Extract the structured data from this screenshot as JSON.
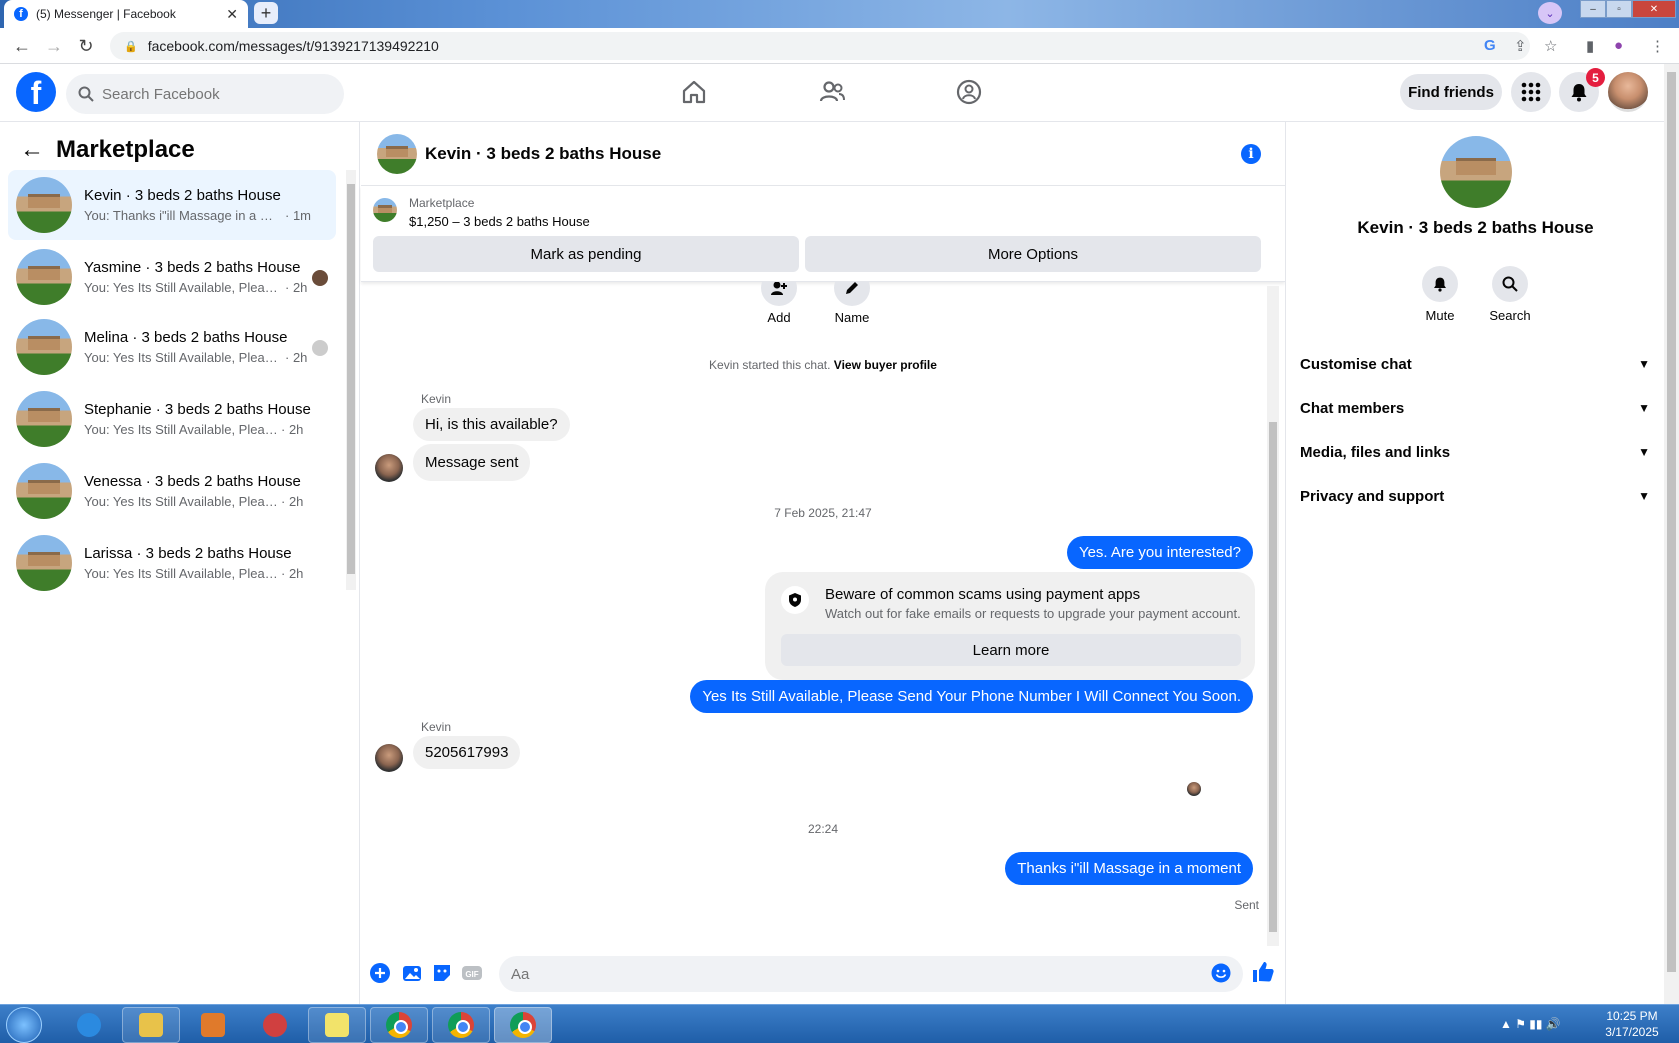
{
  "browser": {
    "tab_title": "(5) Messenger | Facebook",
    "url": "facebook.com/messages/t/9139217139492210"
  },
  "header": {
    "search_placeholder": "Search Facebook",
    "find_friends": "Find friends",
    "notification_count": "5"
  },
  "left": {
    "title": "Marketplace",
    "conversations": [
      {
        "name": "Kevin · 3 beds 2 baths House",
        "preview": "You: Thanks i\"ill Massage in a mo...",
        "time": "· 1m",
        "active": true
      },
      {
        "name": "Yasmine · 3 beds 2 baths House",
        "preview": "You: Yes Its Still Available, Please...",
        "time": "· 2h"
      },
      {
        "name": "Melina · 3 beds 2 baths House",
        "preview": "You: Yes Its Still Available, Please...",
        "time": "· 2h"
      },
      {
        "name": "Stephanie · 3 beds 2 baths House",
        "preview": "You: Yes Its Still Available, Please Se...",
        "time": "· 2h"
      },
      {
        "name": "Venessa · 3 beds 2 baths House",
        "preview": "You: Yes Its Still Available, Please Se...",
        "time": "· 2h"
      },
      {
        "name": "Larissa · 3 beds 2 baths House",
        "preview": "You: Yes Its Still Available, Please Se...",
        "time": "· 2h"
      }
    ]
  },
  "chat": {
    "title": "Kevin · 3 beds 2 baths House",
    "marketplace_label": "Marketplace",
    "listing": "$1,250 – 3 beds 2 baths House",
    "mark_pending": "Mark as pending",
    "more_options": "More Options",
    "action_add": "Add",
    "action_name": "Name",
    "started_text": "Kevin started this chat.",
    "view_profile": "View buyer profile",
    "sender_kevin": "Kevin",
    "msg_1": "Hi, is this available?",
    "msg_2": "Message sent",
    "timestamp_1": "7 Feb 2025, 21:47",
    "msg_3": "Yes. Are you interested?",
    "scam_title": "Beware of common scams using payment apps",
    "scam_sub": "Watch out for fake emails or requests to upgrade your payment account.",
    "learn_more": "Learn more",
    "msg_4": "Yes Its Still Available, Please Send Your Phone Number I Will Connect You Soon.",
    "msg_5": "5205617993",
    "timestamp_2": "22:24",
    "msg_6": "Thanks i\"ill Massage in a moment",
    "sent_label": "Sent",
    "input_placeholder": "Aa"
  },
  "right": {
    "name": "Kevin · 3 beds 2 baths House",
    "mute": "Mute",
    "search": "Search",
    "sections": [
      "Customise chat",
      "Chat members",
      "Media, files and links",
      "Privacy and support"
    ]
  },
  "taskbar": {
    "time": "10:25 PM",
    "date": "3/17/2025"
  },
  "colors": {
    "accent": "#0866ff",
    "active_conv": "#ebf5ff",
    "bubble_in": "#f0f0f0"
  }
}
